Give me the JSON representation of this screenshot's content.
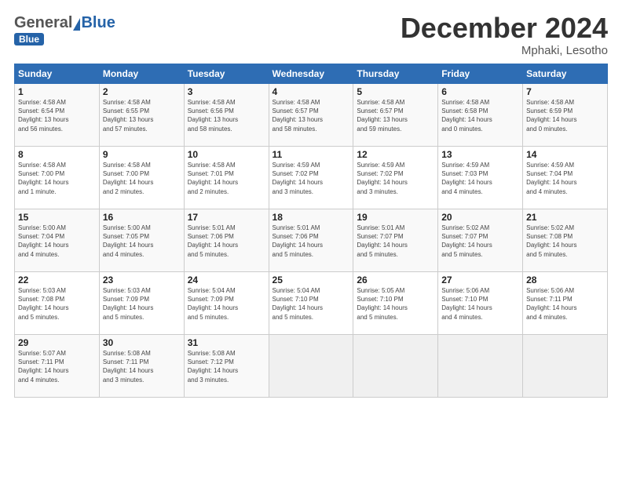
{
  "header": {
    "logo_general": "General",
    "logo_blue": "Blue",
    "title": "December 2024",
    "location": "Mphaki, Lesotho"
  },
  "weekdays": [
    "Sunday",
    "Monday",
    "Tuesday",
    "Wednesday",
    "Thursday",
    "Friday",
    "Saturday"
  ],
  "weeks": [
    [
      {
        "day": "1",
        "info": "Sunrise: 4:58 AM\nSunset: 6:54 PM\nDaylight: 13 hours\nand 56 minutes."
      },
      {
        "day": "2",
        "info": "Sunrise: 4:58 AM\nSunset: 6:55 PM\nDaylight: 13 hours\nand 57 minutes."
      },
      {
        "day": "3",
        "info": "Sunrise: 4:58 AM\nSunset: 6:56 PM\nDaylight: 13 hours\nand 58 minutes."
      },
      {
        "day": "4",
        "info": "Sunrise: 4:58 AM\nSunset: 6:57 PM\nDaylight: 13 hours\nand 58 minutes."
      },
      {
        "day": "5",
        "info": "Sunrise: 4:58 AM\nSunset: 6:57 PM\nDaylight: 13 hours\nand 59 minutes."
      },
      {
        "day": "6",
        "info": "Sunrise: 4:58 AM\nSunset: 6:58 PM\nDaylight: 14 hours\nand 0 minutes."
      },
      {
        "day": "7",
        "info": "Sunrise: 4:58 AM\nSunset: 6:59 PM\nDaylight: 14 hours\nand 0 minutes."
      }
    ],
    [
      {
        "day": "8",
        "info": "Sunrise: 4:58 AM\nSunset: 7:00 PM\nDaylight: 14 hours\nand 1 minute."
      },
      {
        "day": "9",
        "info": "Sunrise: 4:58 AM\nSunset: 7:00 PM\nDaylight: 14 hours\nand 2 minutes."
      },
      {
        "day": "10",
        "info": "Sunrise: 4:58 AM\nSunset: 7:01 PM\nDaylight: 14 hours\nand 2 minutes."
      },
      {
        "day": "11",
        "info": "Sunrise: 4:59 AM\nSunset: 7:02 PM\nDaylight: 14 hours\nand 3 minutes."
      },
      {
        "day": "12",
        "info": "Sunrise: 4:59 AM\nSunset: 7:02 PM\nDaylight: 14 hours\nand 3 minutes."
      },
      {
        "day": "13",
        "info": "Sunrise: 4:59 AM\nSunset: 7:03 PM\nDaylight: 14 hours\nand 4 minutes."
      },
      {
        "day": "14",
        "info": "Sunrise: 4:59 AM\nSunset: 7:04 PM\nDaylight: 14 hours\nand 4 minutes."
      }
    ],
    [
      {
        "day": "15",
        "info": "Sunrise: 5:00 AM\nSunset: 7:04 PM\nDaylight: 14 hours\nand 4 minutes."
      },
      {
        "day": "16",
        "info": "Sunrise: 5:00 AM\nSunset: 7:05 PM\nDaylight: 14 hours\nand 4 minutes."
      },
      {
        "day": "17",
        "info": "Sunrise: 5:01 AM\nSunset: 7:06 PM\nDaylight: 14 hours\nand 5 minutes."
      },
      {
        "day": "18",
        "info": "Sunrise: 5:01 AM\nSunset: 7:06 PM\nDaylight: 14 hours\nand 5 minutes."
      },
      {
        "day": "19",
        "info": "Sunrise: 5:01 AM\nSunset: 7:07 PM\nDaylight: 14 hours\nand 5 minutes."
      },
      {
        "day": "20",
        "info": "Sunrise: 5:02 AM\nSunset: 7:07 PM\nDaylight: 14 hours\nand 5 minutes."
      },
      {
        "day": "21",
        "info": "Sunrise: 5:02 AM\nSunset: 7:08 PM\nDaylight: 14 hours\nand 5 minutes."
      }
    ],
    [
      {
        "day": "22",
        "info": "Sunrise: 5:03 AM\nSunset: 7:08 PM\nDaylight: 14 hours\nand 5 minutes."
      },
      {
        "day": "23",
        "info": "Sunrise: 5:03 AM\nSunset: 7:09 PM\nDaylight: 14 hours\nand 5 minutes."
      },
      {
        "day": "24",
        "info": "Sunrise: 5:04 AM\nSunset: 7:09 PM\nDaylight: 14 hours\nand 5 minutes."
      },
      {
        "day": "25",
        "info": "Sunrise: 5:04 AM\nSunset: 7:10 PM\nDaylight: 14 hours\nand 5 minutes."
      },
      {
        "day": "26",
        "info": "Sunrise: 5:05 AM\nSunset: 7:10 PM\nDaylight: 14 hours\nand 5 minutes."
      },
      {
        "day": "27",
        "info": "Sunrise: 5:06 AM\nSunset: 7:10 PM\nDaylight: 14 hours\nand 4 minutes."
      },
      {
        "day": "28",
        "info": "Sunrise: 5:06 AM\nSunset: 7:11 PM\nDaylight: 14 hours\nand 4 minutes."
      }
    ],
    [
      {
        "day": "29",
        "info": "Sunrise: 5:07 AM\nSunset: 7:11 PM\nDaylight: 14 hours\nand 4 minutes."
      },
      {
        "day": "30",
        "info": "Sunrise: 5:08 AM\nSunset: 7:11 PM\nDaylight: 14 hours\nand 3 minutes."
      },
      {
        "day": "31",
        "info": "Sunrise: 5:08 AM\nSunset: 7:12 PM\nDaylight: 14 hours\nand 3 minutes."
      },
      {
        "day": "",
        "info": ""
      },
      {
        "day": "",
        "info": ""
      },
      {
        "day": "",
        "info": ""
      },
      {
        "day": "",
        "info": ""
      }
    ]
  ]
}
